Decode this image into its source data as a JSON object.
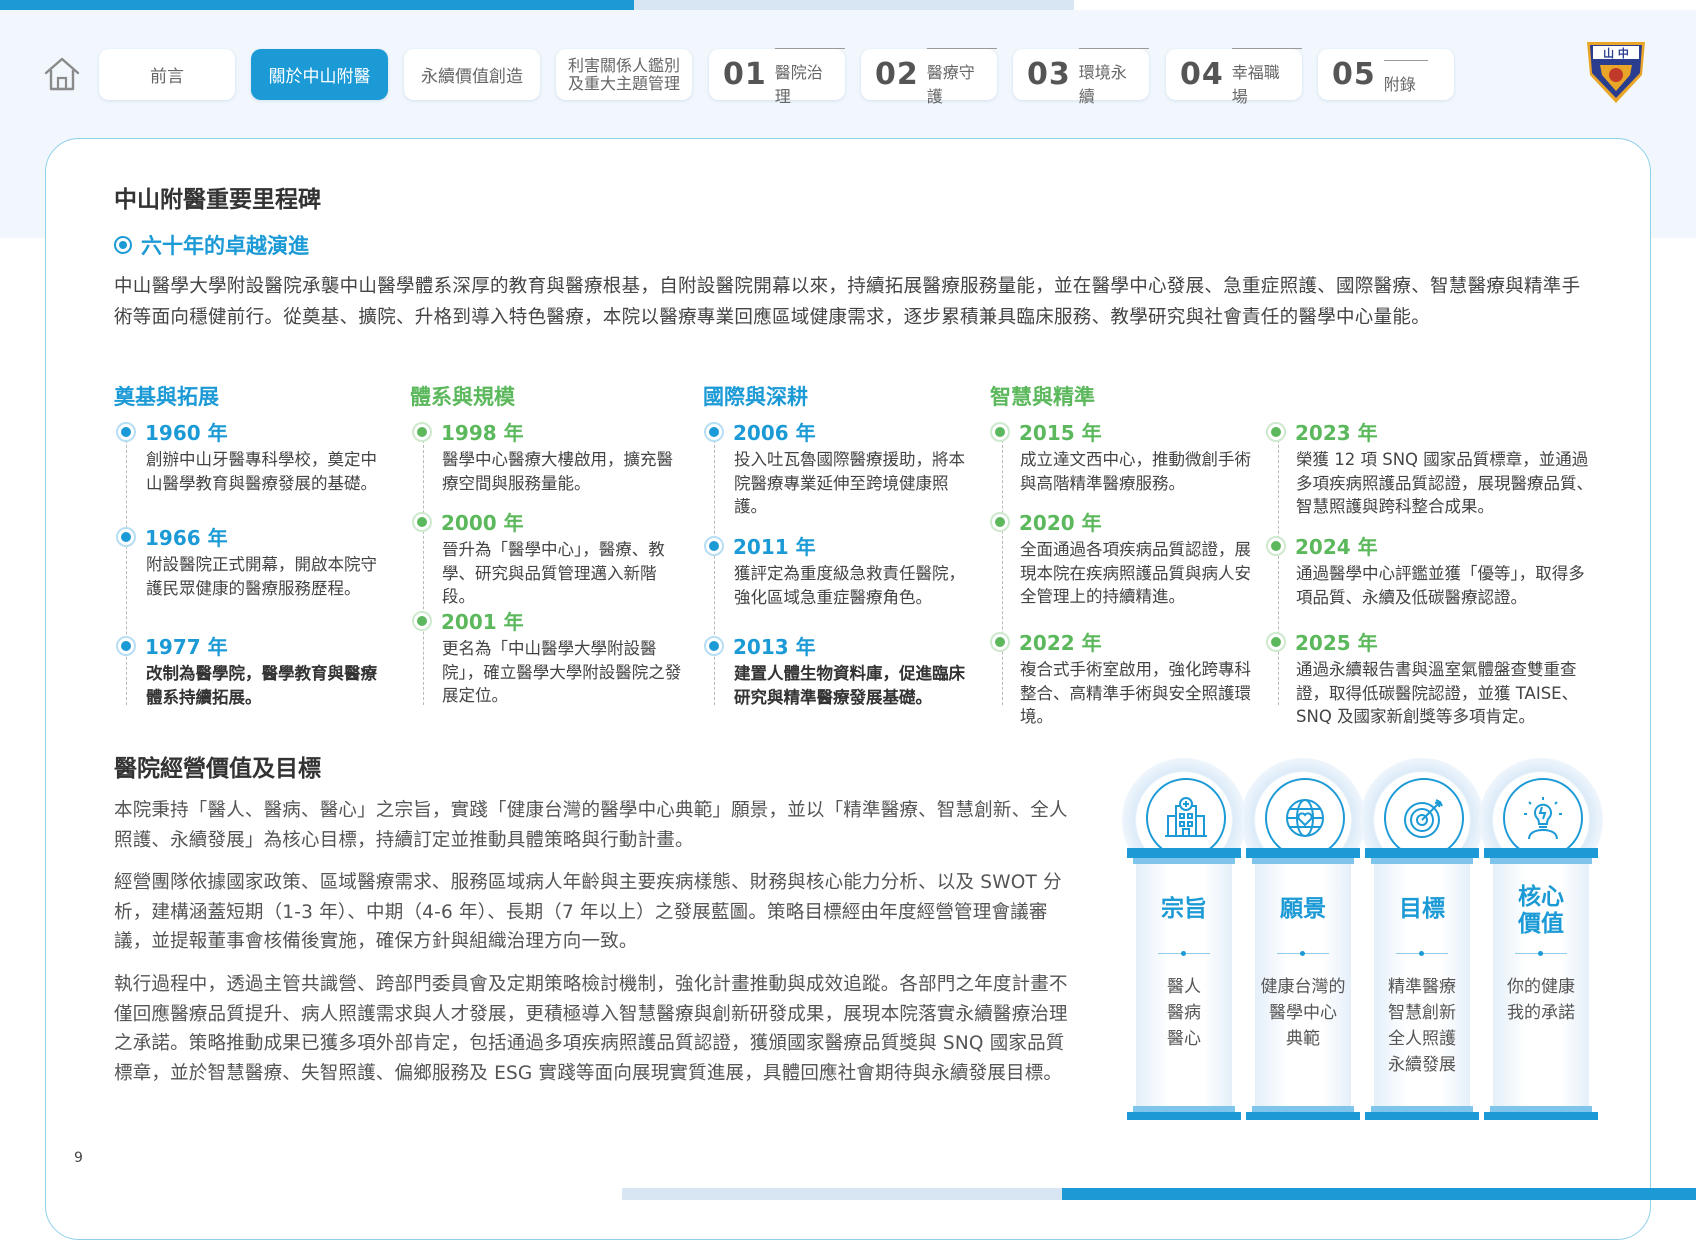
{
  "nav": {
    "tabs": [
      {
        "label": "前言"
      },
      {
        "label": "關於中山附醫"
      },
      {
        "label": "永續價值創造"
      },
      {
        "label_line1": "利害關係人鑑別",
        "label_line2": "及重大主題管理"
      },
      {
        "num": "01",
        "label": "醫院治理"
      },
      {
        "num": "02",
        "label": "醫療守護"
      },
      {
        "num": "03",
        "label": "環境永續"
      },
      {
        "num": "04",
        "label": "幸福職場"
      },
      {
        "num": "05",
        "label": "附錄"
      }
    ],
    "logo_text": "山 中"
  },
  "milestones": {
    "title": "中山附醫重要里程碑",
    "subtitle": "六十年的卓越演進",
    "intro": "中山醫學大學附設醫院承襲中山醫學體系深厚的教育與醫療根基，自附設醫院開幕以來，持續拓展醫療服務量能，並在醫學中心發展、急重症照護、國際醫療、智慧醫療與精準手術等面向穩健前行。從奠基、擴院、升格到導入特色醫療，本院以醫療專業回應區域健康需求，逐步累積兼具臨床服務、教學研究與社會責任的醫學中心量能。",
    "columns": [
      {
        "heading": "奠基與拓展",
        "items": [
          {
            "year": "1960 年",
            "text": "創辦中山牙醫專科學校，奠定中山醫學教育與醫療發展的基礎。"
          },
          {
            "year": "1966 年",
            "text": "附設醫院正式開幕，開啟本院守護民眾健康的醫療服務歷程。"
          },
          {
            "year": "1977 年",
            "text": "改制為醫學院，醫學教育與醫療體系持續拓展。"
          }
        ]
      },
      {
        "heading": "體系與規模",
        "items": [
          {
            "year": "1998 年",
            "text": "醫學中心醫療大樓啟用，擴充醫療空間與服務量能。"
          },
          {
            "year": "2000 年",
            "text": "晉升為「醫學中心」，醫療、教學、研究與品質管理邁入新階段。"
          },
          {
            "year": "2001 年",
            "text": "更名為「中山醫學大學附設醫院」，確立醫學大學附設醫院之發展定位。"
          }
        ]
      },
      {
        "heading": "國際與深耕",
        "items": [
          {
            "year": "2006 年",
            "text": "投入吐瓦魯國際醫療援助，將本院醫療專業延伸至跨境健康照護。"
          },
          {
            "year": "2011 年",
            "text": "獲評定為重度級急救責任醫院，強化區域急重症醫療角色。"
          },
          {
            "year": "2013 年",
            "text": "建置人體生物資料庫，促進臨床研究與精準醫療發展基礎。"
          }
        ]
      },
      {
        "heading": "智慧與精準",
        "items": [
          {
            "year": "2015 年",
            "text": "成立達文西中心，推動微創手術與高階精準醫療服務。"
          },
          {
            "year": "2020 年",
            "text": "全面通過各項疾病品質認證，展現本院在疾病照護品質與病人安全管理上的持續精進。"
          },
          {
            "year": "2022 年",
            "text": "複合式手術室啟用，強化跨專科整合、高精準手術與安全照護環境。"
          }
        ]
      },
      {
        "heading": "",
        "items": [
          {
            "year": "2023 年",
            "text": "榮獲 12 項 SNQ 國家品質標章，並通過多項疾病照護品質認證，展現醫療品質、智慧照護與跨科整合成果。"
          },
          {
            "year": "2024 年",
            "text": "通過醫學中心評鑑並獲「優等」，取得多項品質、永續及低碳醫療認證。"
          },
          {
            "year": "2025 年",
            "text": "通過永續報告書與溫室氣體盤查雙重查證，取得低碳醫院認證，並獲 TAISE、SNQ 及國家新創獎等多項肯定。"
          }
        ]
      }
    ]
  },
  "values": {
    "title": "醫院經營價值及目標",
    "paragraphs": [
      "本院秉持「醫人、醫病、醫心」之宗旨，實踐「健康台灣的醫學中心典範」願景，並以「精準醫療、智慧創新、全人照護、永續發展」為核心目標，持續訂定並推動具體策略與行動計畫。",
      "經營團隊依據國家政策、區域醫療需求、服務區域病人年齡與主要疾病樣態、財務與核心能力分析、以及 SWOT 分析，建構涵蓋短期（1-3 年）、中期（4-6 年）、長期（7 年以上）之發展藍圖。策略目標經由年度經營管理會議審議，並提報董事會核備後實施，確保方針與組織治理方向一致。",
      "執行過程中，透過主管共識營、跨部門委員會及定期策略檢討機制，強化計畫推動與成效追蹤。各部門之年度計畫不僅回應醫療品質提升、病人照護需求與人才發展，更積極導入智慧醫療與創新研發成果，展現本院落實永續醫療治理之承諾。策略推動成果已獲多項外部肯定，包括通過多項疾病照護品質認證，獲頒國家醫療品質獎與 SNQ 國家品質標章，並於智慧醫療、失智照護、偏鄉服務及 ESG 實踐等面向展現實質進展，具體回應社會期待與永續發展目標。"
    ],
    "pillars": [
      {
        "title": "宗旨",
        "icon": "hospital-icon",
        "lines": [
          "醫人",
          "醫病",
          "醫心"
        ]
      },
      {
        "title": "願景",
        "icon": "globe-heart-icon",
        "lines": [
          "健康台灣的",
          "醫學中心",
          "典範"
        ]
      },
      {
        "title": "目標",
        "icon": "target-icon",
        "lines": [
          "精準醫療",
          "智慧創新",
          "全人照護",
          "永續發展"
        ]
      },
      {
        "title_line1": "核心",
        "title_line2": "價值",
        "icon": "lightbulb-person-icon",
        "lines": [
          "你的健康",
          "我的承諾"
        ]
      }
    ]
  },
  "page_number": "9",
  "colors": {
    "accent_blue": "#1c9ad6",
    "accent_green": "#5cb85c"
  }
}
